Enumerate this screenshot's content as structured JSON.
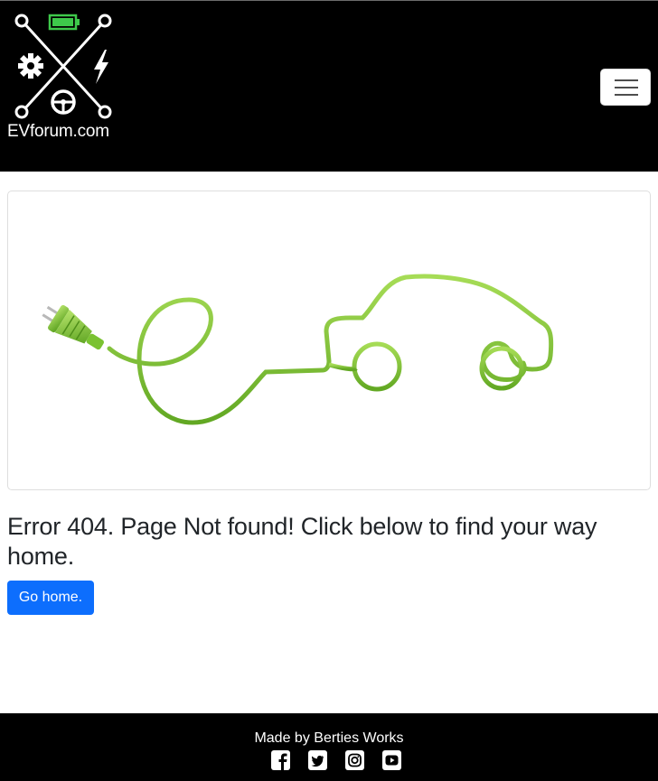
{
  "navbar": {
    "brand_name": "EVforum.com",
    "menu_toggle_icon": "hamburger-icon"
  },
  "hero": {
    "image": "ev-plug-cable-car-illustration",
    "cable_color": "#7ac231"
  },
  "main": {
    "error_message": "Error 404. Page Not found! Click below to find your way home.",
    "home_button_label": "Go home."
  },
  "footer": {
    "credit": "Made by Berties Works",
    "social_icons": [
      "facebook-icon",
      "twitter-icon",
      "instagram-icon",
      "youtube-icon"
    ]
  },
  "colors": {
    "navbar_bg": "#000000",
    "primary_button": "#0d6efd",
    "battery_green": "#3ec94b"
  }
}
